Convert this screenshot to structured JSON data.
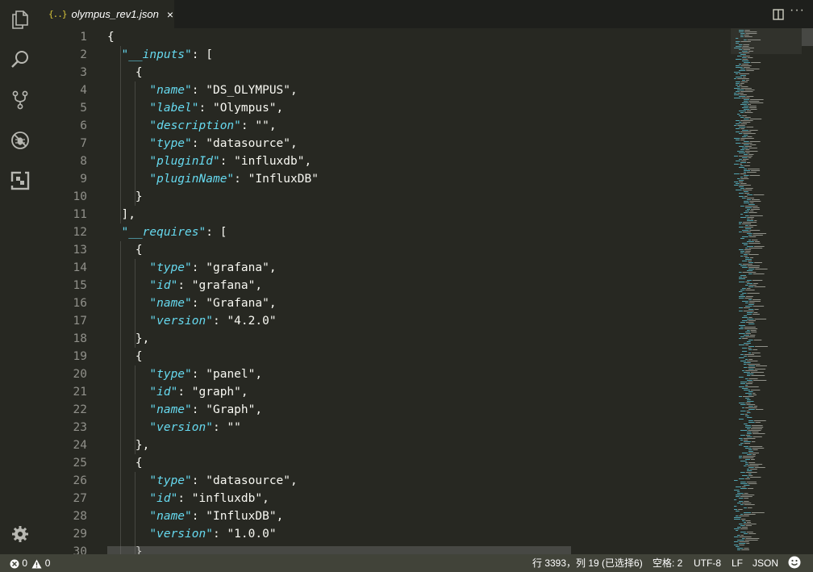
{
  "tab": {
    "icon": "{..}",
    "title": "olympus_rev1.json",
    "close": "×"
  },
  "toolbar": {
    "more": "···"
  },
  "activity": {
    "items": [
      "files-icon",
      "search-icon",
      "source-control-icon",
      "debug-icon",
      "extensions-icon"
    ],
    "bottom": "gear-icon"
  },
  "editor": {
    "language": "json",
    "lines": [
      {
        "n": "1",
        "tokens": [
          [
            "p",
            "{"
          ]
        ]
      },
      {
        "n": "2",
        "tokens": [
          [
            "p",
            "  "
          ],
          [
            "k",
            "\"__inputs\""
          ],
          [
            "p",
            ": ["
          ]
        ]
      },
      {
        "n": "3",
        "tokens": [
          [
            "p",
            "    {"
          ]
        ]
      },
      {
        "n": "4",
        "tokens": [
          [
            "p",
            "      "
          ],
          [
            "k",
            "\"name\""
          ],
          [
            "p",
            ": "
          ],
          [
            "p",
            "\"DS_OLYMPUS\""
          ],
          [
            "p",
            ","
          ]
        ]
      },
      {
        "n": "5",
        "tokens": [
          [
            "p",
            "      "
          ],
          [
            "k",
            "\"label\""
          ],
          [
            "p",
            ": "
          ],
          [
            "p",
            "\"Olympus\""
          ],
          [
            "p",
            ","
          ]
        ]
      },
      {
        "n": "6",
        "tokens": [
          [
            "p",
            "      "
          ],
          [
            "k",
            "\"description\""
          ],
          [
            "p",
            ": "
          ],
          [
            "p",
            "\"\""
          ],
          [
            "p",
            ","
          ]
        ]
      },
      {
        "n": "7",
        "tokens": [
          [
            "p",
            "      "
          ],
          [
            "k",
            "\"type\""
          ],
          [
            "p",
            ": "
          ],
          [
            "p",
            "\"datasource\""
          ],
          [
            "p",
            ","
          ]
        ]
      },
      {
        "n": "8",
        "tokens": [
          [
            "p",
            "      "
          ],
          [
            "k",
            "\"pluginId\""
          ],
          [
            "p",
            ": "
          ],
          [
            "p",
            "\"influxdb\""
          ],
          [
            "p",
            ","
          ]
        ]
      },
      {
        "n": "9",
        "tokens": [
          [
            "p",
            "      "
          ],
          [
            "k",
            "\"pluginName\""
          ],
          [
            "p",
            ": "
          ],
          [
            "p",
            "\"InfluxDB\""
          ]
        ]
      },
      {
        "n": "10",
        "tokens": [
          [
            "p",
            "    }"
          ]
        ]
      },
      {
        "n": "11",
        "tokens": [
          [
            "p",
            "  ],"
          ]
        ]
      },
      {
        "n": "12",
        "tokens": [
          [
            "p",
            "  "
          ],
          [
            "k",
            "\"__requires\""
          ],
          [
            "p",
            ": ["
          ]
        ]
      },
      {
        "n": "13",
        "tokens": [
          [
            "p",
            "    {"
          ]
        ]
      },
      {
        "n": "14",
        "tokens": [
          [
            "p",
            "      "
          ],
          [
            "k",
            "\"type\""
          ],
          [
            "p",
            ": "
          ],
          [
            "p",
            "\"grafana\""
          ],
          [
            "p",
            ","
          ]
        ]
      },
      {
        "n": "15",
        "tokens": [
          [
            "p",
            "      "
          ],
          [
            "k",
            "\"id\""
          ],
          [
            "p",
            ": "
          ],
          [
            "p",
            "\"grafana\""
          ],
          [
            "p",
            ","
          ]
        ]
      },
      {
        "n": "16",
        "tokens": [
          [
            "p",
            "      "
          ],
          [
            "k",
            "\"name\""
          ],
          [
            "p",
            ": "
          ],
          [
            "p",
            "\"Grafana\""
          ],
          [
            "p",
            ","
          ]
        ]
      },
      {
        "n": "17",
        "tokens": [
          [
            "p",
            "      "
          ],
          [
            "k",
            "\"version\""
          ],
          [
            "p",
            ": "
          ],
          [
            "p",
            "\"4.2.0\""
          ]
        ]
      },
      {
        "n": "18",
        "tokens": [
          [
            "p",
            "    },"
          ]
        ]
      },
      {
        "n": "19",
        "tokens": [
          [
            "p",
            "    {"
          ]
        ]
      },
      {
        "n": "20",
        "tokens": [
          [
            "p",
            "      "
          ],
          [
            "k",
            "\"type\""
          ],
          [
            "p",
            ": "
          ],
          [
            "p",
            "\"panel\""
          ],
          [
            "p",
            ","
          ]
        ]
      },
      {
        "n": "21",
        "tokens": [
          [
            "p",
            "      "
          ],
          [
            "k",
            "\"id\""
          ],
          [
            "p",
            ": "
          ],
          [
            "p",
            "\"graph\""
          ],
          [
            "p",
            ","
          ]
        ]
      },
      {
        "n": "22",
        "tokens": [
          [
            "p",
            "      "
          ],
          [
            "k",
            "\"name\""
          ],
          [
            "p",
            ": "
          ],
          [
            "p",
            "\"Graph\""
          ],
          [
            "p",
            ","
          ]
        ]
      },
      {
        "n": "23",
        "tokens": [
          [
            "p",
            "      "
          ],
          [
            "k",
            "\"version\""
          ],
          [
            "p",
            ": "
          ],
          [
            "p",
            "\"\""
          ]
        ]
      },
      {
        "n": "24",
        "tokens": [
          [
            "p",
            "    },"
          ]
        ]
      },
      {
        "n": "25",
        "tokens": [
          [
            "p",
            "    {"
          ]
        ]
      },
      {
        "n": "26",
        "tokens": [
          [
            "p",
            "      "
          ],
          [
            "k",
            "\"type\""
          ],
          [
            "p",
            ": "
          ],
          [
            "p",
            "\"datasource\""
          ],
          [
            "p",
            ","
          ]
        ]
      },
      {
        "n": "27",
        "tokens": [
          [
            "p",
            "      "
          ],
          [
            "k",
            "\"id\""
          ],
          [
            "p",
            ": "
          ],
          [
            "p",
            "\"influxdb\""
          ],
          [
            "p",
            ","
          ]
        ]
      },
      {
        "n": "28",
        "tokens": [
          [
            "p",
            "      "
          ],
          [
            "k",
            "\"name\""
          ],
          [
            "p",
            ": "
          ],
          [
            "p",
            "\"InfluxDB\""
          ],
          [
            "p",
            ","
          ]
        ]
      },
      {
        "n": "29",
        "tokens": [
          [
            "p",
            "      "
          ],
          [
            "k",
            "\"version\""
          ],
          [
            "p",
            ": "
          ],
          [
            "p",
            "\"1.0.0\""
          ]
        ]
      },
      {
        "n": "30",
        "tokens": [
          [
            "p",
            "    }"
          ]
        ]
      }
    ]
  },
  "status": {
    "errors": "0",
    "warnings": "0",
    "position": "行 3393，列 19 (已选择6)",
    "indent": "空格: 2",
    "encoding": "UTF-8",
    "eol": "LF",
    "language": "JSON"
  },
  "colors": {
    "background": "#272822",
    "key": "#66d9ef",
    "text": "#f8f8f2",
    "line_number": "#90908a",
    "status_bar": "#414339"
  }
}
